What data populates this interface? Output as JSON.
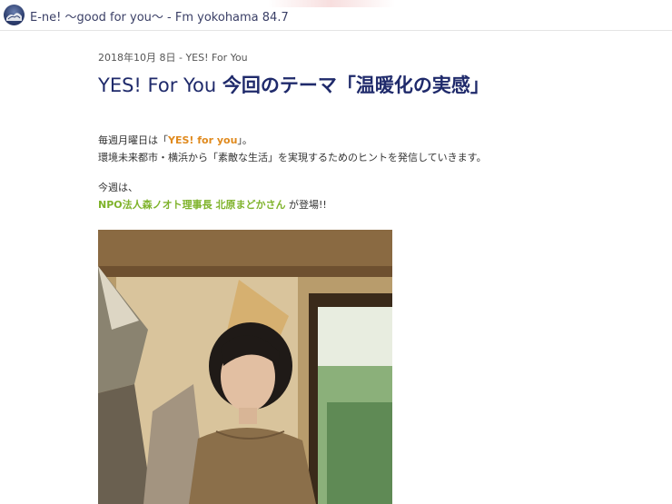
{
  "header": {
    "site_title": "E-ne! 〜good for you〜 - Fm yokohama 84.7",
    "logo_icon": "station-logo-icon"
  },
  "post": {
    "date": "2018年10月 8日 - YES! For You",
    "title_en": "YES! For You ",
    "title_jp": "今回のテーマ「温暖化の実感」",
    "para1_prefix": "毎週月曜日は「",
    "para1_link": "YES! for you",
    "para1_suffix": "」。",
    "para2": "環境未来都市・横浜から「素敵な生活」を実現するためのヒントを発信していきます。",
    "para3": "今週は、",
    "guest_name": "NPO法人森ノオト理事長 北原まどかさん",
    "guest_suffix": " が登場!!"
  },
  "colors": {
    "title": "#1f2a6b",
    "link_orange": "#e08a1e",
    "guest_green": "#7fb32b"
  }
}
